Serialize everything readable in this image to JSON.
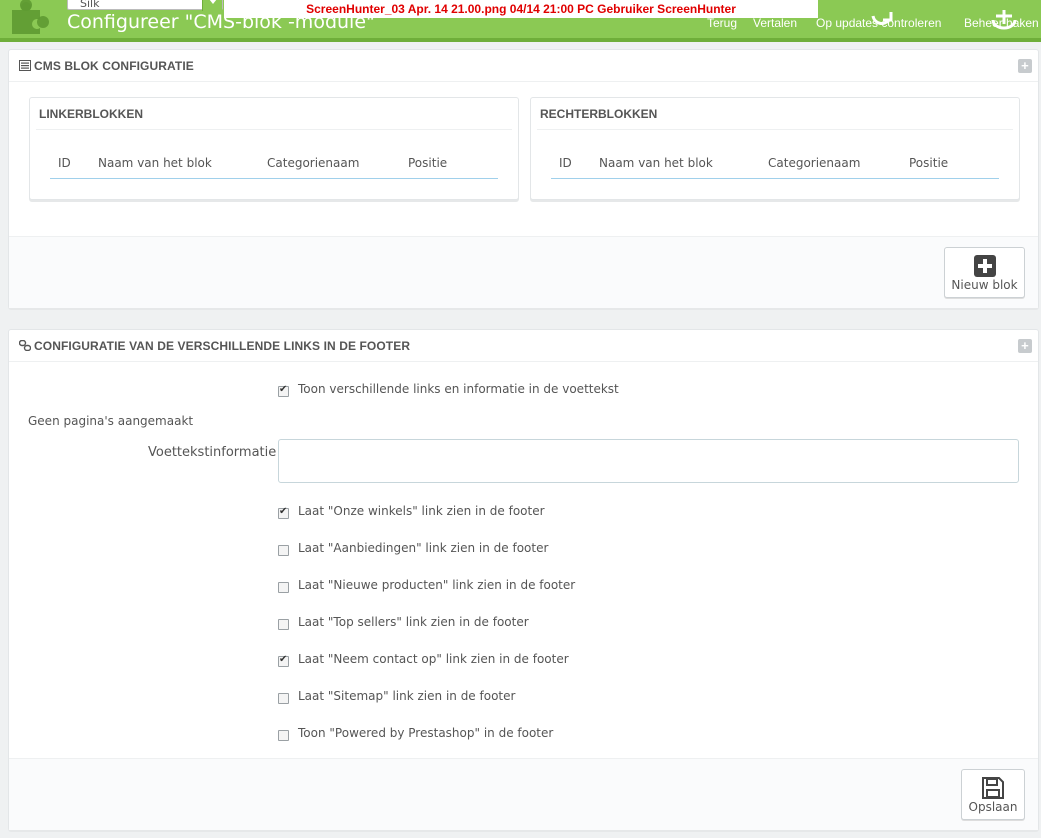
{
  "header": {
    "shop_select": "Silk",
    "title": "Configureer \"CMS-blok -module\"",
    "watermark": "ScreenHunter_03 Apr. 14 21.00.png  04/14  21:00  PC  Gebruiker  ScreenHunter",
    "toolbar": [
      {
        "label": "Terug",
        "icon": "back-icon"
      },
      {
        "label": "Vertalen",
        "icon": "translate-icon"
      },
      {
        "label": "Op updates controleren",
        "icon": "refresh-icon"
      },
      {
        "label": "Beheer haken",
        "icon": "anchor-icon"
      }
    ]
  },
  "cms_panel": {
    "title": "CMS BLOK CONFIGURATIE",
    "left": {
      "title": "LINKERBLOKKEN",
      "columns": [
        "ID",
        "Naam van het blok",
        "Categorienaam",
        "Positie"
      ]
    },
    "right": {
      "title": "RECHTERBLOKKEN",
      "columns": [
        "ID",
        "Naam van het blok",
        "Categorienaam",
        "Positie"
      ]
    },
    "new_block_label": "Nieuw blok"
  },
  "footer_panel": {
    "title": "CONFIGURATIE VAN DE VERSCHILLENDE LINKS IN DE FOOTER",
    "show_links": {
      "label": "Toon verschillende links en informatie in de voettekst",
      "checked": true
    },
    "no_pages": "Geen pagina's aangemaakt",
    "footer_info_label": "Voettekstinformatie",
    "footer_info_value": "",
    "options": [
      {
        "label": "Laat \"Onze winkels\" link zien in de footer",
        "checked": true
      },
      {
        "label": "Laat \"Aanbiedingen\" link zien in de footer",
        "checked": false
      },
      {
        "label": "Laat \"Nieuwe producten\" link zien in de footer",
        "checked": false
      },
      {
        "label": "Laat \"Top sellers\" link zien in de footer",
        "checked": false
      },
      {
        "label": "Laat \"Neem contact op\" link zien in de footer",
        "checked": true
      },
      {
        "label": "Laat \"Sitemap\" link zien in de footer",
        "checked": false
      },
      {
        "label": "Toon \"Powered by Prestashop\" in de footer",
        "checked": false
      }
    ],
    "save_label": "Opslaan"
  },
  "colors": {
    "header_green": "#8bc954",
    "accent_blue": "#a0d0eb"
  }
}
